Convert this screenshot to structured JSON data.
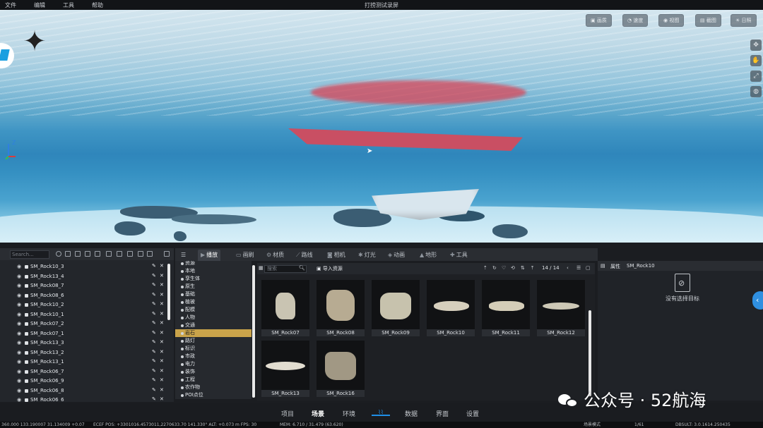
{
  "menu": {
    "file": "文件",
    "edit": "编辑",
    "tools": "工具",
    "help": "帮助",
    "title": "打捞测试录屏"
  },
  "viewport": {
    "buttons": [
      "画质",
      "速度",
      "视图",
      "截图",
      "日照"
    ],
    "axis_label": "Z",
    "colors": {
      "sea": "#3f95c4",
      "hull": "#c94f63",
      "floor": "#e2f4fb"
    }
  },
  "outliner": {
    "search_placeholder": "Search...",
    "items": [
      "SM_Rock10_3",
      "SM_Rock13_4",
      "SM_Rock08_7",
      "SM_Rock08_6",
      "SM_Rock10_2",
      "SM_Rock10_1",
      "SM_Rock07_2",
      "SM_Rock07_1",
      "SM_Rock13_3",
      "SM_Rock13_2",
      "SM_Rock13_1",
      "SM_Rock06_7",
      "SM_Rock06_9",
      "SM_Rock06_8",
      "SM_Rock06_6"
    ]
  },
  "tabs": [
    "播放",
    "画刷",
    "材质",
    "路线",
    "相机",
    "灯光",
    "动画",
    "地形",
    "工具"
  ],
  "tree": {
    "root": "资源",
    "items": [
      "本地",
      "孪生体",
      "原生",
      "基础",
      "植被",
      "配模",
      "人物",
      "交通",
      "岩石",
      "路灯",
      "标识",
      "市政",
      "电力",
      "装饰",
      "工程",
      "农作物",
      "POI点位"
    ],
    "selected": "岩石"
  },
  "assets": {
    "search_placeholder": "搜索",
    "import_label": "导入资源",
    "page": "14 / 14",
    "cards": [
      "SM_Rock07",
      "SM_Rock08",
      "SM_Rock09",
      "SM_Rock10",
      "SM_Rock11",
      "SM_Rock12",
      "SM_Rock13",
      "SM_Rock16"
    ]
  },
  "props": {
    "title": "属性",
    "object": "SM_Rock10",
    "empty_text": "没有选择目标"
  },
  "bottom_nav": [
    "项目",
    "场景",
    "环境",
    "数据",
    "界面",
    "设置"
  ],
  "bottom_active": "场景",
  "status": {
    "s1": "360.000   133.190007 31.134009 +0.07",
    "s2": "ECEF POS: +3301016.4573011,2270633.70   141.330°  ALT: +0.073 m   FPS: 30",
    "s3": "MEM: 6.710 / 31.479 (63.620)",
    "s4": "场景模式",
    "s5": "1/61",
    "s6": "DBSULT:  3.0.1614.250435"
  },
  "watermark": "公众号 · 52航海"
}
